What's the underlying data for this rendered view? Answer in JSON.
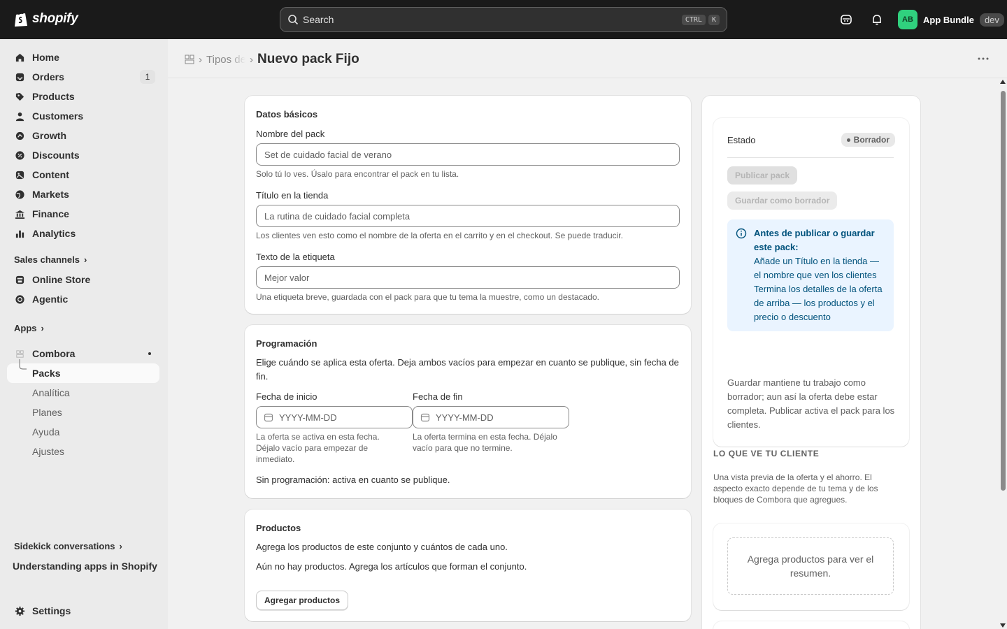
{
  "topbar": {
    "logo_text": "shopify",
    "search_label": "Search",
    "shortcut_1": "CTRL",
    "shortcut_2": "K",
    "avatar_initials": "AB",
    "store_name": "App Bundle",
    "dev_badge": "dev"
  },
  "sidebar": {
    "items": [
      {
        "label": "Home",
        "icon": "home-icon"
      },
      {
        "label": "Orders",
        "icon": "inbox-icon",
        "count": "1"
      },
      {
        "label": "Products",
        "icon": "tag-icon"
      },
      {
        "label": "Customers",
        "icon": "person-icon"
      },
      {
        "label": "Growth",
        "icon": "growth-icon"
      },
      {
        "label": "Discounts",
        "icon": "discount-icon"
      },
      {
        "label": "Content",
        "icon": "content-icon"
      },
      {
        "label": "Markets",
        "icon": "globe-icon"
      },
      {
        "label": "Finance",
        "icon": "bank-icon"
      },
      {
        "label": "Analytics",
        "icon": "bar-chart-icon"
      }
    ],
    "sales_channels_label": "Sales channels",
    "channels": [
      {
        "label": "Online Store",
        "icon": "store-icon"
      },
      {
        "label": "Agentic",
        "icon": "agentic-icon"
      }
    ],
    "apps_label": "Apps",
    "app_name": "Combora",
    "app_items": [
      "Packs",
      "Analítica",
      "Planes",
      "Ayuda",
      "Ajustes"
    ],
    "sidekick_label": "Sidekick conversations",
    "sidekick_item": "Understanding apps in Shopify",
    "settings_label": "Settings"
  },
  "header": {
    "crumb_parent": "Tipos de",
    "title": "Nuevo pack Fijo"
  },
  "basics": {
    "title": "Datos básicos",
    "name_label": "Nombre del pack",
    "name_placeholder": "Set de cuidado facial de verano",
    "name_help": "Solo tú lo ves. Úsalo para encontrar el pack en tu lista.",
    "store_title_label": "Título en la tienda",
    "store_title_placeholder": "La rutina de cuidado facial completa",
    "store_title_help": "Los clientes ven esto como el nombre de la oferta en el carrito y en el checkout. Se puede traducir.",
    "tag_label": "Texto de la etiqueta",
    "tag_placeholder": "Mejor valor",
    "tag_help": "Una etiqueta breve, guardada con el pack para que tu tema la muestre, como un destacado."
  },
  "schedule": {
    "title": "Programación",
    "description": "Elige cuándo se aplica esta oferta. Deja ambos vacíos para empezar en cuanto se publique, sin fecha de fin.",
    "start_label": "Fecha de inicio",
    "start_placeholder": "YYYY-MM-DD",
    "start_help": "La oferta se activa en esta fecha. Déjalo vacío para empezar de inmediato.",
    "end_label": "Fecha de fin",
    "end_placeholder": "YYYY-MM-DD",
    "end_help": "La oferta termina en esta fecha. Déjalo vacío para que no termine.",
    "summary": "Sin programación: activa en cuanto se publique."
  },
  "products": {
    "title": "Productos",
    "description": "Agrega los productos de este conjunto y cuántos de cada uno.",
    "empty": "Aún no hay productos. Agrega los artículos que forman el conjunto.",
    "add_button": "Agregar productos"
  },
  "status": {
    "label": "Estado",
    "badge": "Borrador",
    "publish_button": "Publicar pack",
    "save_draft_button": "Guardar como borrador",
    "banner_title": "Antes de publicar o guardar este pack:",
    "banner_item_1": "Añade un Título en la tienda — el nombre que ven los clientes",
    "banner_item_2": "Termina los detalles de la oferta de arriba — los productos y el precio o descuento",
    "note": "Guardar mantiene tu trabajo como borrador; aun así la oferta debe estar completa. Publicar activa el pack para los clientes."
  },
  "preview": {
    "heading": "LO QUE VE TU CLIENTE",
    "description": "Una vista previa de la oferta y el ahorro. El aspecto exacto depende de tu tema y de los bloques de Combora que agregues.",
    "empty": "Agrega productos para ver el resumen."
  },
  "colors": {
    "topbar": "#1a1a1a",
    "banner_bg": "#eaf4ff",
    "banner_text": "#00527c",
    "avatar": "#30d17e"
  }
}
